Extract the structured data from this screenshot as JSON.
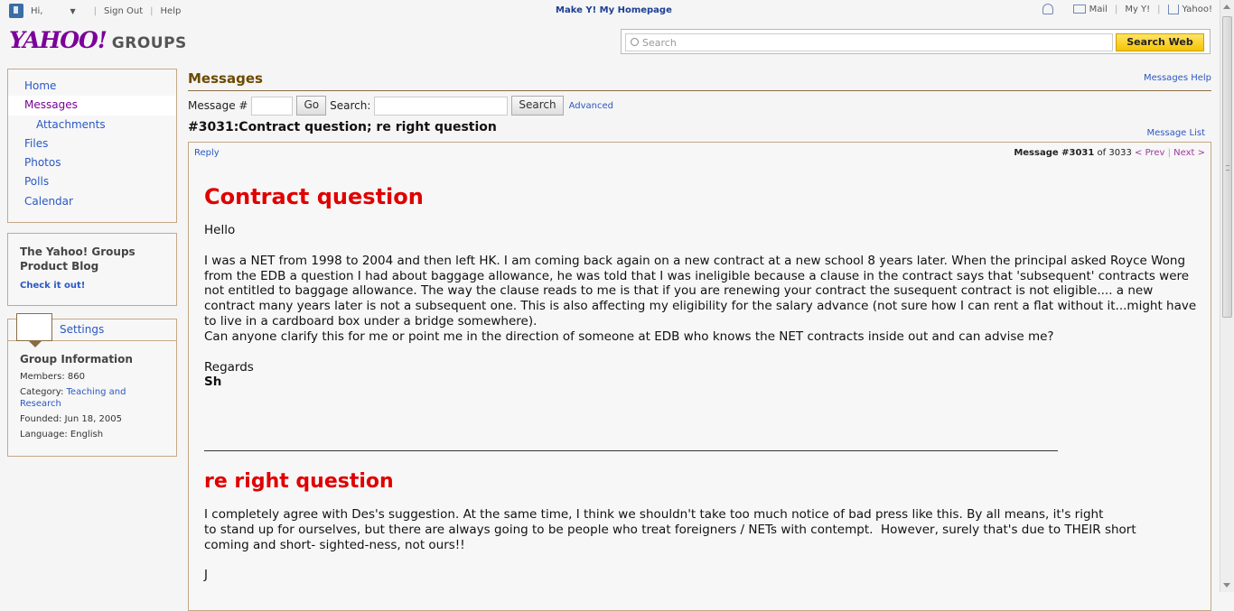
{
  "topbar": {
    "hi": "Hi,",
    "sign_out": "Sign Out",
    "help": "Help",
    "center": "Make Y! My Homepage",
    "mail": "Mail",
    "myy": "My Y!",
    "yahoo": "Yahoo!"
  },
  "logo": {
    "yahoo": "YAHOO!",
    "groups": "GROUPS"
  },
  "search": {
    "placeholder": "Search",
    "button": "Search Web"
  },
  "nav": {
    "items": [
      "Home",
      "Messages",
      "Attachments",
      "Files",
      "Photos",
      "Polls",
      "Calendar"
    ]
  },
  "blog": {
    "title": "The Yahoo! Groups Product Blog",
    "link": "Check it out!"
  },
  "info": {
    "settings": "Settings",
    "heading": "Group Information",
    "members_label": "Members:",
    "members": "860",
    "category_label": "Category:",
    "category": "Teaching and Research",
    "founded_label": "Founded:",
    "founded": "Jun 18, 2005",
    "language_label": "Language:",
    "language": "English"
  },
  "main": {
    "title": "Messages",
    "help": "Messages Help",
    "msg_label": "Message #",
    "go": "Go",
    "search_label": "Search:",
    "search_btn": "Search",
    "advanced": "Advanced",
    "subject": "#3031:Contract question; re right question",
    "message_list": "Message List"
  },
  "message": {
    "reply": "Reply",
    "pager_label": "Message #3031",
    "pager_of": "of 3033",
    "prev": "< Prev",
    "next": "Next >",
    "heading1": "Contract question",
    "greeting": "Hello",
    "body1": "I was a NET from 1998 to 2004 and then left HK. I am coming back again on a new contract at a new school 8 years later. When the principal asked Royce Wong from the EDB a question I had about baggage allowance, he was told that I was ineligible because a clause in the contract says that 'subsequent' contracts were not entitled to baggage allowance. The way the clause reads to me is that if you are renewing your contract the susequent contract is not eligible.... a new contract many years later is not a subsequent one. This is also affecting my eligibility for the salary advance (not sure how I can rent a flat without it...might have to live in a cardboard box under a bridge somewhere).\nCan anyone clarify this for me or point me in the direction of someone at EDB who knows the NET contracts inside out and can advise me?",
    "regards": "Regards",
    "sig1": "Sh",
    "heading2": "re right question",
    "body2": "I completely agree with Des's suggestion. At the same time, I think we shouldn't take too much notice of bad press like this. By all means, it's right\nto stand up for ourselves, but there are always going to be people who treat foreigners / NETs with contempt.  However, surely that's due to THEIR short\ncoming and short- sighted-ness, not ours!!",
    "sig2": "J"
  },
  "colors": {
    "brand": "#7b0099",
    "link": "#2b58c4",
    "heading_red": "#e00000",
    "border": "#c4a886"
  }
}
